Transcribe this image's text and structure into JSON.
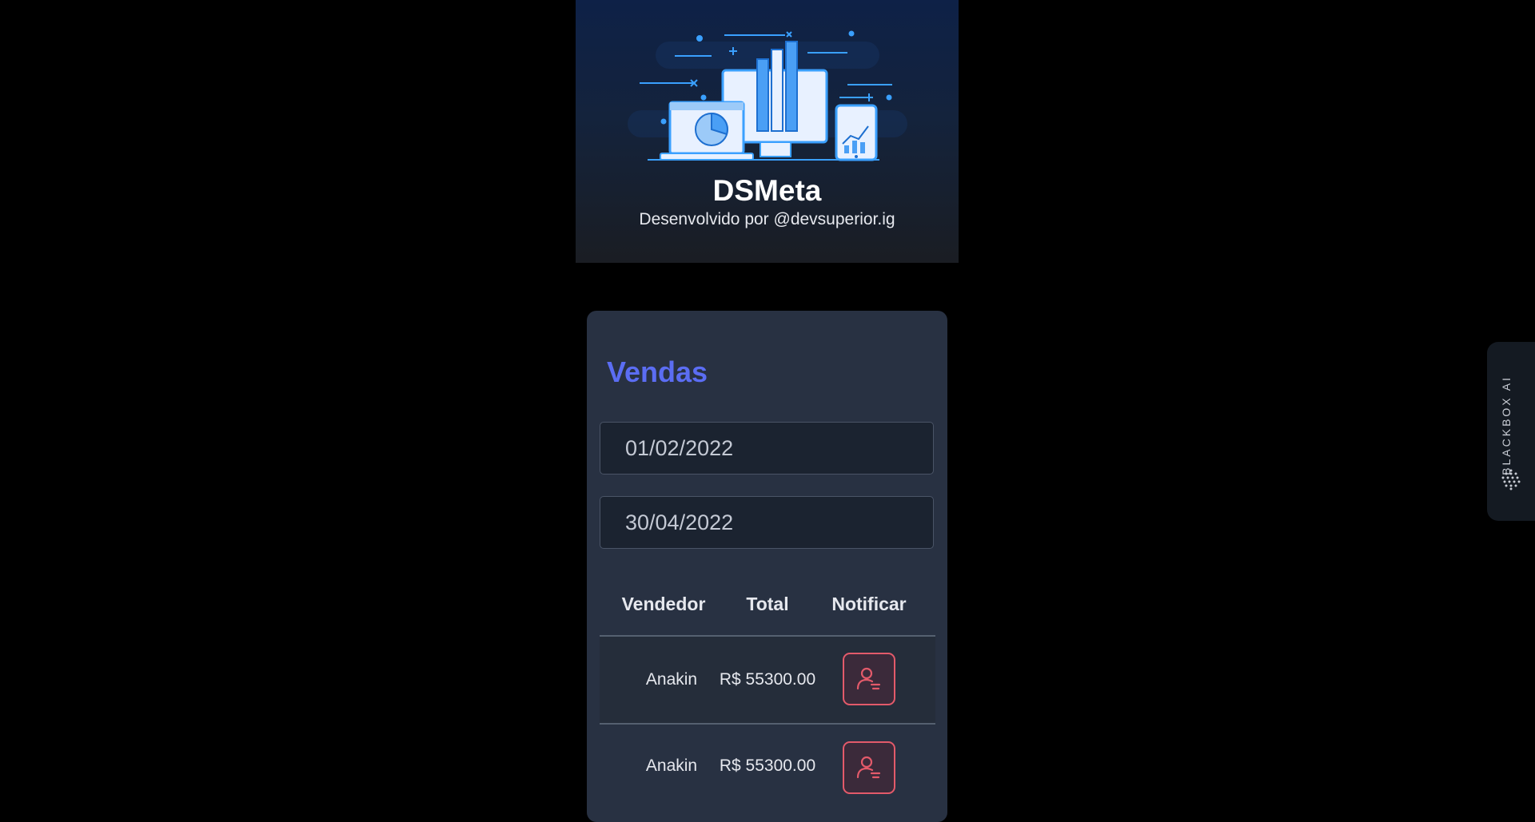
{
  "header": {
    "title": "DSMeta",
    "subtitle": "Desenvolvido por @devsuperior.ig"
  },
  "sales_card": {
    "title": "Vendas",
    "min_date": "01/02/2022",
    "max_date": "30/04/2022",
    "columns": [
      "Vendedor",
      "Total",
      "Notificar"
    ],
    "rows": [
      {
        "seller": "Anakin",
        "total": "R$ 55300.00"
      },
      {
        "seller": "Anakin",
        "total": "R$ 55300.00"
      }
    ]
  },
  "extension": {
    "label": "BLACKBOX AI"
  },
  "colors": {
    "accent": "#5b6df3",
    "notify": "#e35a6a",
    "card": "#283142"
  },
  "icons": [
    "dashboard-illustration",
    "notify-user-icon",
    "blackbox-logo-icon"
  ]
}
